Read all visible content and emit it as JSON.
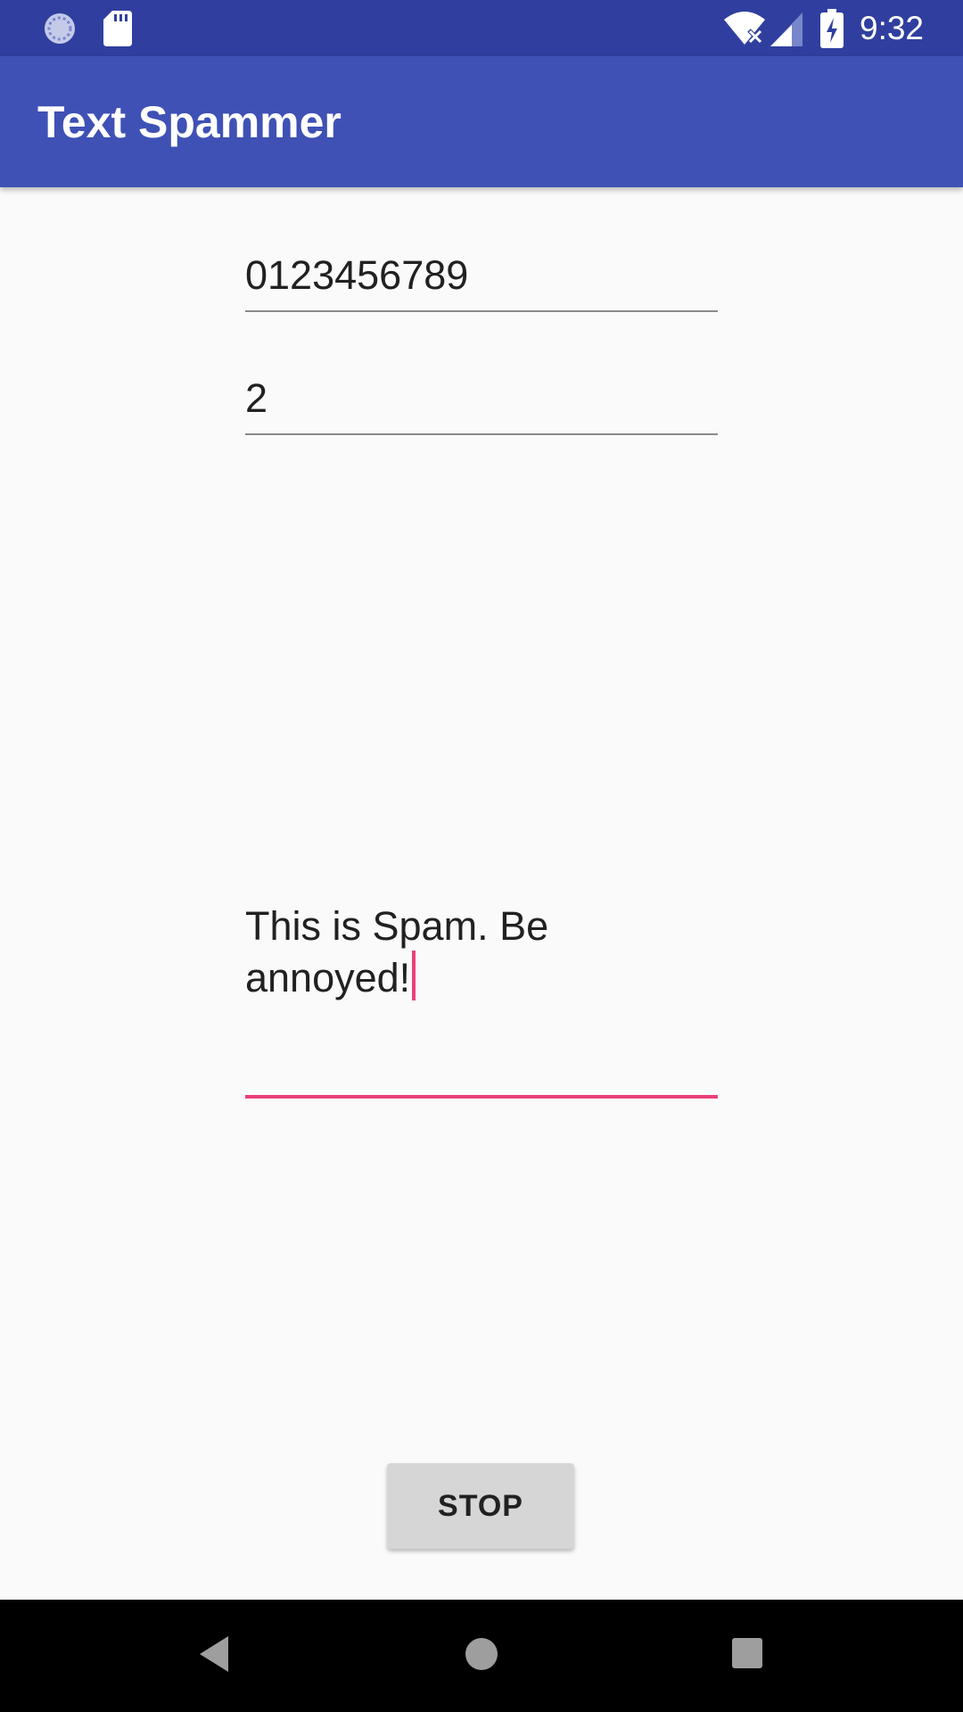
{
  "status_bar": {
    "time": "9:32",
    "icons": [
      "sync-icon",
      "sd-card-icon",
      "wifi-icon",
      "signal-icon",
      "battery-icon"
    ]
  },
  "app_bar": {
    "title": "Text Spammer"
  },
  "form": {
    "phone_number": "0123456789",
    "count": "2",
    "message": "This is Spam. Be\nannoyed!"
  },
  "actions": {
    "stop_label": "STOP"
  },
  "nav_bar": {
    "icons": [
      "back-icon",
      "home-icon",
      "recents-icon"
    ]
  },
  "colors": {
    "status_bar": "#303F9F",
    "app_bar": "#3F51B5",
    "accent": "#EC407A",
    "background": "#FAFAFA"
  }
}
